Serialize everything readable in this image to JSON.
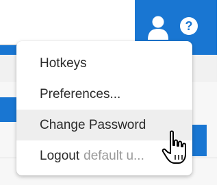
{
  "header": {
    "user_icon": "user-icon",
    "help_icon": "help-icon",
    "help_glyph": "?"
  },
  "user_menu": {
    "items": [
      {
        "label": "Hotkeys"
      },
      {
        "label": "Preferences..."
      },
      {
        "label": "Change Password",
        "hovered": true
      },
      {
        "label": "Logout",
        "sublabel": "default u..."
      }
    ]
  },
  "colors": {
    "accent": "#1976d2",
    "menu_hover": "#eeeeee",
    "text": "#2a2a2a",
    "muted_text": "#9a9a9a"
  },
  "cursor": "hand-pointer"
}
